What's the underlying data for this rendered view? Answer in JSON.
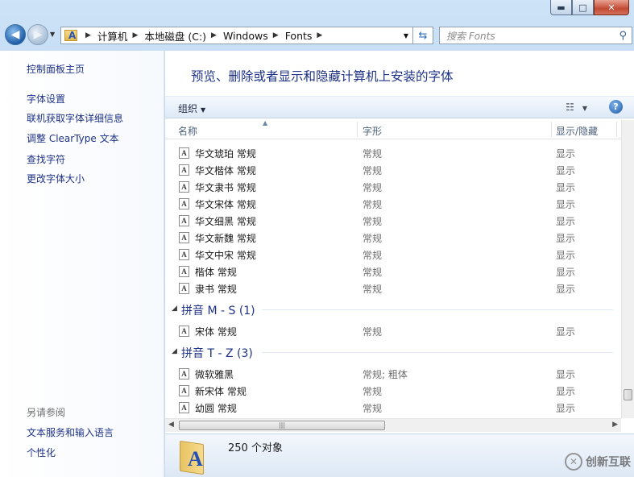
{
  "window": {
    "controls": {
      "minimize": "▬",
      "maximize": "□",
      "close": "✕"
    }
  },
  "navbar": {
    "breadcrumb": [
      "计算机",
      "本地磁盘 (C:)",
      "Windows",
      "Fonts"
    ],
    "search_placeholder": "搜索 Fonts"
  },
  "sidebar": {
    "home": "控制面板主页",
    "links": [
      "字体设置",
      "联机获取字体详细信息",
      "调整 ClearType 文本",
      "查找字符",
      "更改字体大小"
    ],
    "see_also_title": "另请参阅",
    "see_also": [
      "文本服务和输入语言",
      "个性化"
    ]
  },
  "main": {
    "title": "预览、删除或者显示和隐藏计算机上安装的字体",
    "organize_label": "组织",
    "columns": {
      "name": "名称",
      "style": "字形",
      "show_hide": "显示/隐藏"
    },
    "rows_top": [
      {
        "name": "华文琥珀 常规",
        "style": "常规",
        "show": "显示"
      },
      {
        "name": "华文楷体 常规",
        "style": "常规",
        "show": "显示"
      },
      {
        "name": "华文隶书 常规",
        "style": "常规",
        "show": "显示"
      },
      {
        "name": "华文宋体 常规",
        "style": "常规",
        "show": "显示"
      },
      {
        "name": "华文细黑 常规",
        "style": "常规",
        "show": "显示"
      },
      {
        "name": "华文新魏 常规",
        "style": "常规",
        "show": "显示"
      },
      {
        "name": "华文中宋 常规",
        "style": "常规",
        "show": "显示"
      },
      {
        "name": "楷体 常规",
        "style": "常规",
        "show": "显示"
      },
      {
        "name": "隶书 常规",
        "style": "常规",
        "show": "显示"
      }
    ],
    "group_ms": {
      "label": "拼音 M - S (1)",
      "rows": [
        {
          "name": "宋体 常规",
          "style": "常规",
          "show": "显示"
        }
      ]
    },
    "group_tz": {
      "label": "拼音 T - Z (3)",
      "rows": [
        {
          "name": "微软雅黑",
          "style": "常规; 粗体",
          "show": "显示"
        },
        {
          "name": "新宋体 常规",
          "style": "常规",
          "show": "显示"
        },
        {
          "name": "幼圆 常规",
          "style": "常规",
          "show": "显示"
        }
      ]
    }
  },
  "details": {
    "count": "250 个对象",
    "watermark": "创新互联"
  }
}
